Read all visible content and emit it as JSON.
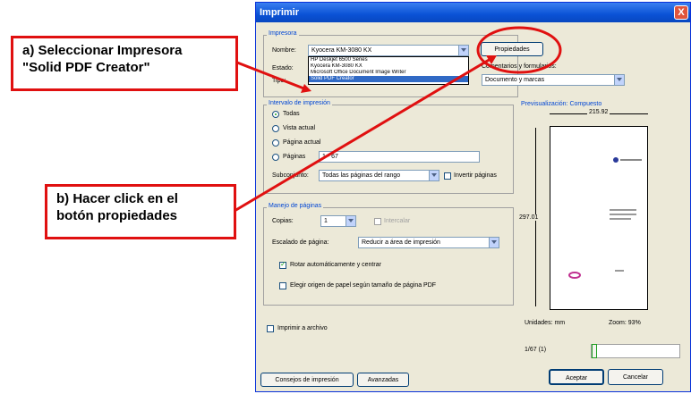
{
  "callouts": {
    "a_line1": "a) Seleccionar Impresora",
    "a_line2": "\"Solid PDF Creator\"",
    "b_line1": "b) Hacer click en el",
    "b_line2": "botón propiedades"
  },
  "dialog": {
    "title": "Imprimir",
    "close": "X",
    "printer": {
      "group": "Impresora",
      "name_label": "Nombre:",
      "name_value": "Kyocera KM-3080 KX",
      "status_label": "Estado:",
      "type_label": "Tipo:",
      "options": [
        "HP Deskjet 6500 Series",
        "Kyocera KM-3080 KX",
        "Microsoft Office Document Image Writer",
        "Solid PDF Creator"
      ],
      "selected_index": 3,
      "properties_button": "Propiedades",
      "comments_label": "Comentarios y formularios:",
      "comments_value": "Documento y marcas"
    },
    "range": {
      "group": "Intervalo de impresión",
      "all": "Todas",
      "current_view": "Vista actual",
      "current_page": "Página actual",
      "pages": "Páginas",
      "pages_value": "1 - 67",
      "subset_label": "Subconjunto:",
      "subset_value": "Todas las páginas del rango",
      "reverse": "Invertir páginas"
    },
    "handling": {
      "group": "Manejo de páginas",
      "copies_label": "Copias:",
      "copies_value": "1",
      "collate": "Intercalar",
      "scaling_label": "Escalado de página:",
      "scaling_value": "Reducir a área de impresión",
      "auto_rotate": "Rotar automáticamente y centrar",
      "choose_source": "Elegir origen de papel según tamaño de página PDF"
    },
    "print_to_file": "Imprimir a archivo",
    "preview": {
      "label": "Previsualización: Compuesto",
      "width": "215.92",
      "height": "297.01",
      "units": "Unidades: mm",
      "zoom": "Zoom: 93%",
      "page": "1/67 (1)"
    },
    "buttons": {
      "tips": "Consejos de impresión",
      "advanced": "Avanzadas",
      "accept": "Aceptar",
      "cancel": "Cancelar"
    }
  }
}
